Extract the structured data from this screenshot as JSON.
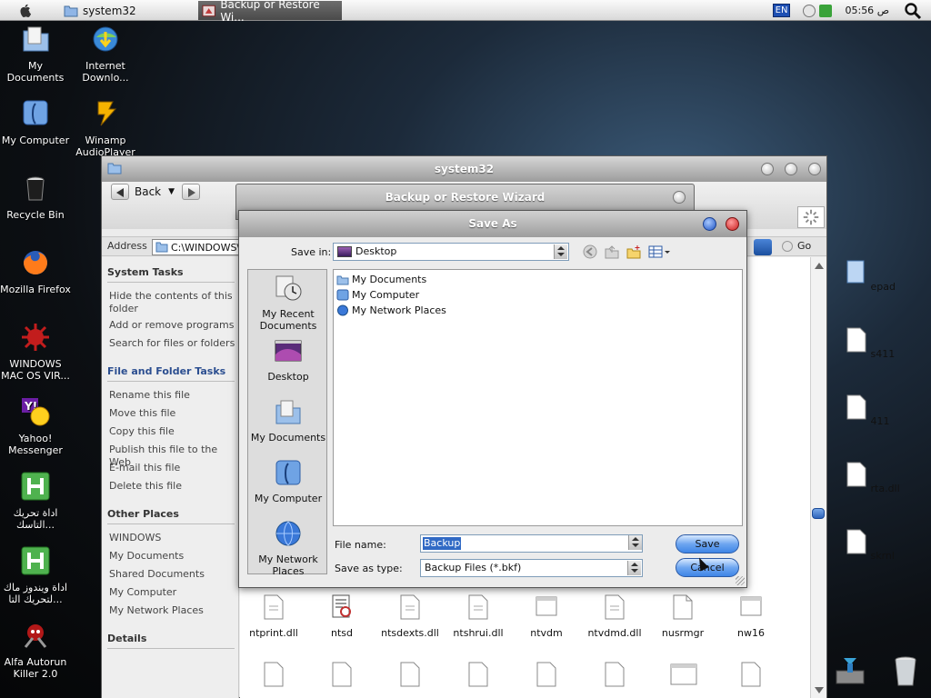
{
  "menubar": {
    "tasks": [
      "system32",
      "Backup or Restore Wi..."
    ],
    "language": "EN",
    "clock": "05:56 ص"
  },
  "desktop": {
    "icons": [
      {
        "label": "My Documents",
        "icon": "my-documents-icon"
      },
      {
        "label": "Internet Downlo...",
        "icon": "internet-download-manager-icon"
      },
      {
        "label": "My Computer",
        "icon": "my-computer-icon"
      },
      {
        "label": "Winamp AudioPlayer",
        "icon": "winamp-icon"
      },
      {
        "label": "Recycle Bin",
        "icon": "recycle-bin-icon"
      },
      {
        "label": "Mozilla Firefox",
        "icon": "firefox-icon"
      },
      {
        "label": "WINDOWS MAC OS VIR...",
        "icon": "virus-icon"
      },
      {
        "label": "Yahoo! Messenger",
        "icon": "yahoo-messenger-icon"
      },
      {
        "label": "اداة تحريك التاسك...",
        "icon": "h-tool-icon"
      },
      {
        "label": "اداة ويندوز ماك لتحريك التا...",
        "icon": "h-tool-icon"
      },
      {
        "label": "Alfa Autorun Killer 2.0",
        "icon": "autorun-killer-icon"
      }
    ]
  },
  "explorer": {
    "title": "system32",
    "back_label": "Back",
    "address_label": "Address",
    "address_value": "C:\\WINDOWS\\s",
    "go_label": "Go",
    "system_tasks": {
      "heading": "System Tasks",
      "items": [
        "Hide the contents of this folder",
        "Add or remove programs",
        "Search for files or folders"
      ]
    },
    "file_folder_tasks": {
      "heading": "File and Folder Tasks",
      "items": [
        "Rename this file",
        "Move this file",
        "Copy this file",
        "Publish this file to the Web",
        "E-mail this file",
        "Delete this file"
      ]
    },
    "other_places": {
      "heading": "Other Places",
      "items": [
        "WINDOWS",
        "My Documents",
        "Shared Documents",
        "My Computer",
        "My Network Places"
      ]
    },
    "details_heading": "Details",
    "right_partial_files": [
      "epad",
      "s411",
      "411",
      "rta.dll",
      "skrnl"
    ],
    "files_row": [
      "ntprint.dll",
      "ntsd",
      "ntsdexts.dll",
      "ntshrui.dll",
      "ntvdm",
      "ntvdmd.dll",
      "nusrmgr",
      "nw16"
    ]
  },
  "wizard": {
    "title": "Backup or Restore Wizard"
  },
  "save_as": {
    "title": "Save As",
    "save_in_label": "Save in:",
    "save_in_value": "Desktop",
    "places": [
      "My Recent Documents",
      "Desktop",
      "My Documents",
      "My Computer",
      "My Network Places"
    ],
    "list_items": [
      "My Documents",
      "My Computer",
      "My Network Places"
    ],
    "file_name_label": "File name:",
    "file_name_value": "Backup",
    "save_as_type_label": "Save as type:",
    "save_as_type_value": "Backup Files (*.bkf)",
    "save_button": "Save",
    "cancel_button": "Cancel"
  }
}
